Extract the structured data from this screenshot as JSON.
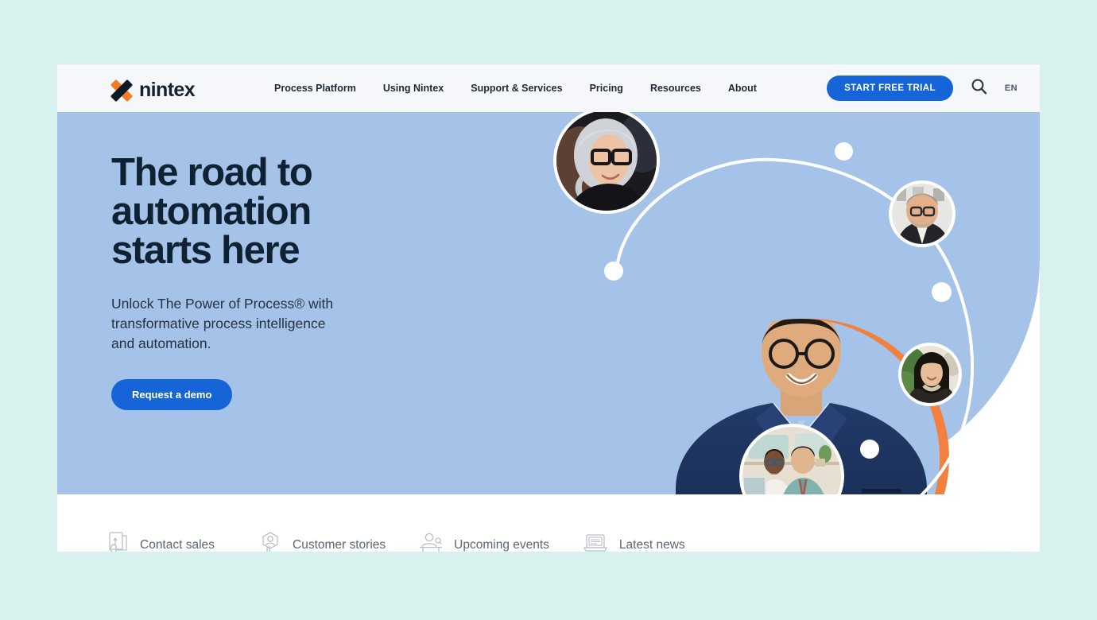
{
  "page": {
    "background_color": "#d8f0ee",
    "frame_background": "#ffffff"
  },
  "header": {
    "background_color": "#f5f7fb",
    "logo": {
      "wordmark": "nintex",
      "icon": "nintex-x-logo",
      "orange": "#f47b20",
      "navy": "#101a24"
    },
    "nav_items": [
      {
        "label": "Process Platform"
      },
      {
        "label": "Using Nintex"
      },
      {
        "label": "Support & Services"
      },
      {
        "label": "Pricing"
      },
      {
        "label": "Resources"
      },
      {
        "label": "About"
      }
    ],
    "trial_button": {
      "label": "START FREE TRIAL",
      "color": "#1565d8"
    },
    "search_icon": "search-icon",
    "language": "EN"
  },
  "hero": {
    "background_color": "#a5c3e8",
    "title": "The road to\nautomation\nstarts here",
    "subtitle": "Unlock The Power of Process® with\ntransformative process intelligence\nand automation.",
    "cta": {
      "label": "Request a demo",
      "color": "#1565d8"
    },
    "accent_circle_color": "#f2813f",
    "orbit": {
      "avatars": [
        {
          "name": "avatar-woman-glasses-grey-hair"
        },
        {
          "name": "avatar-man-grey-beard-glasses"
        },
        {
          "name": "avatar-woman-dark-hair-plants"
        },
        {
          "name": "avatar-two-colleagues-desk"
        }
      ],
      "dots": 4
    },
    "center_photo": "man-in-navy-blazer-with-teal-phone"
  },
  "bottom_links": [
    {
      "label": "Contact sales",
      "icon": "hand-document-icon"
    },
    {
      "label": "Customer stories",
      "icon": "person-badge-icon"
    },
    {
      "label": "Upcoming events",
      "icon": "person-desk-icon"
    },
    {
      "label": "Latest news",
      "icon": "laptop-news-icon"
    }
  ],
  "chat_widget": {
    "icon": "chat-bubble-icon",
    "color": "#1565d8"
  }
}
